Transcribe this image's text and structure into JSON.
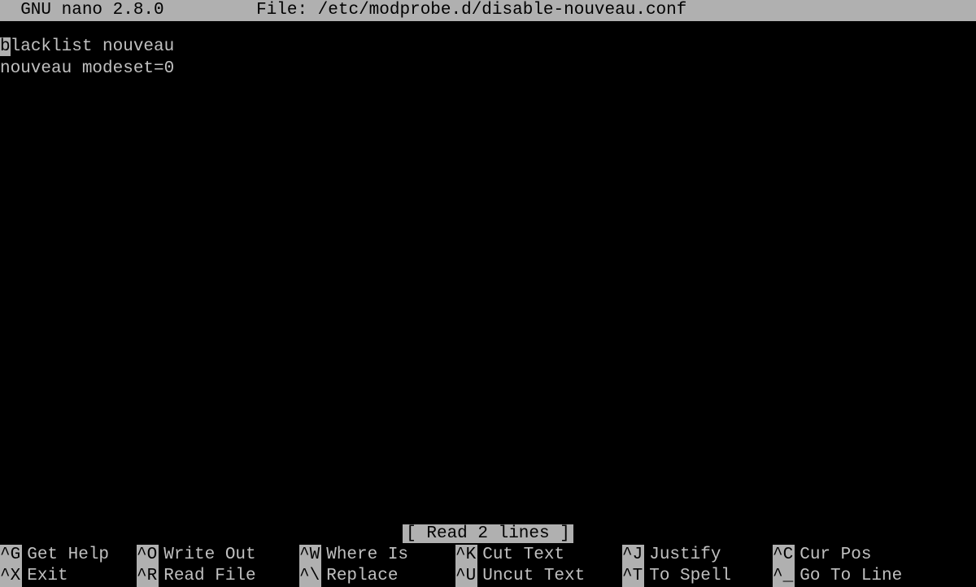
{
  "titlebar": {
    "app": "  GNU nano 2.8.0",
    "spacer": "         ",
    "file": "File: /etc/modprobe.d/disable-nouveau.conf"
  },
  "editor": {
    "cursor_char": "b",
    "line1_rest": "lacklist nouveau",
    "line2": "nouveau modeset=0"
  },
  "status": "[ Read 2 lines ]",
  "shortcuts": {
    "row1": [
      {
        "key": "^G",
        "label": "Get Help"
      },
      {
        "key": "^O",
        "label": "Write Out"
      },
      {
        "key": "^W",
        "label": "Where Is"
      },
      {
        "key": "^K",
        "label": "Cut Text"
      },
      {
        "key": "^J",
        "label": "Justify"
      },
      {
        "key": "^C",
        "label": "Cur Pos"
      }
    ],
    "row2": [
      {
        "key": "^X",
        "label": "Exit"
      },
      {
        "key": "^R",
        "label": "Read File"
      },
      {
        "key": "^\\",
        "label": "Replace"
      },
      {
        "key": "^U",
        "label": "Uncut Text"
      },
      {
        "key": "^T",
        "label": "To Spell"
      },
      {
        "key": "^_",
        "label": "Go To Line"
      }
    ]
  }
}
